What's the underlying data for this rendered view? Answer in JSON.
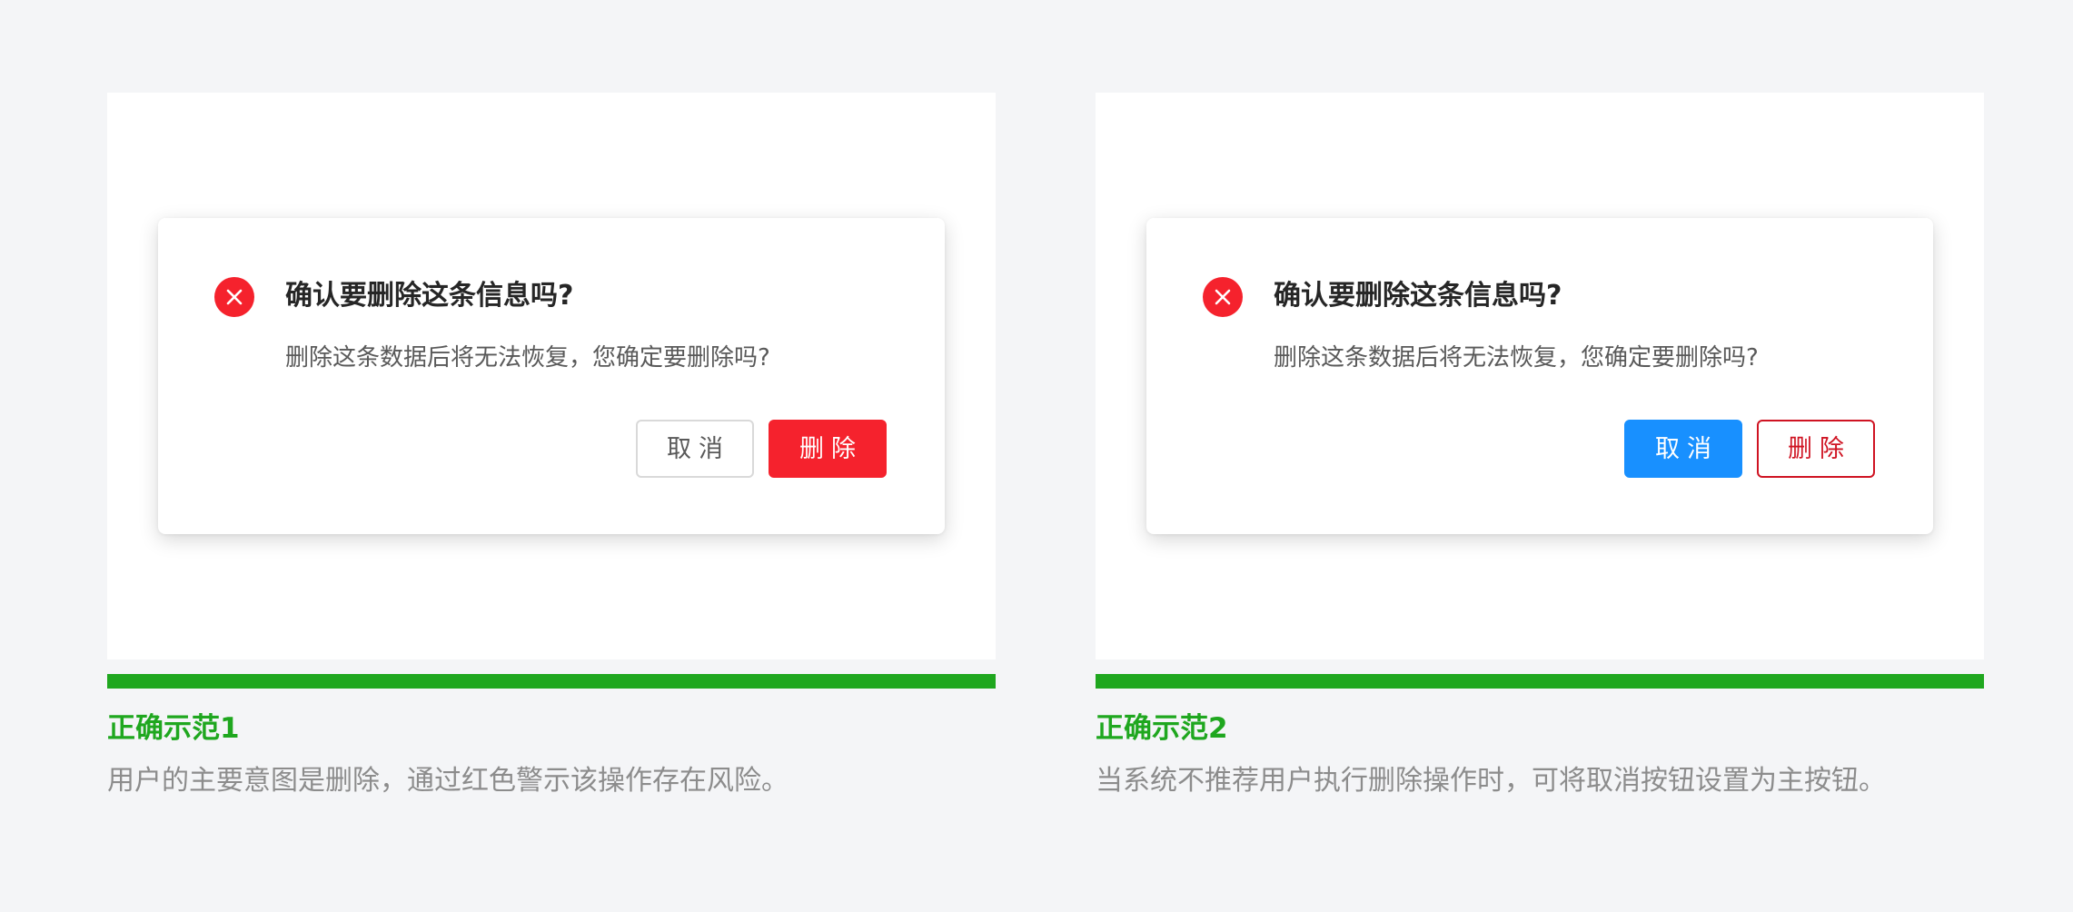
{
  "colors": {
    "page_background": "#f4f5f7",
    "success_green": "#1fa71f",
    "danger_red": "#f5222d",
    "primary_blue": "#1890ff"
  },
  "examples": [
    {
      "dialog": {
        "icon": "close-circle-icon",
        "title": "确认要删除这条信息吗?",
        "message": "删除这条数据后将无法恢复，您确定要删除吗?",
        "cancel_label": "取消",
        "delete_label": "删除"
      },
      "title": "正确示范1",
      "description": "用户的主要意图是删除，通过红色警示该操作存在风险。"
    },
    {
      "dialog": {
        "icon": "close-circle-icon",
        "title": "确认要删除这条信息吗?",
        "message": "删除这条数据后将无法恢复，您确定要删除吗?",
        "cancel_label": "取消",
        "delete_label": "删除"
      },
      "title": "正确示范2",
      "description": "当系统不推荐用户执行删除操作时，可将取消按钮设置为主按钮。"
    }
  ]
}
